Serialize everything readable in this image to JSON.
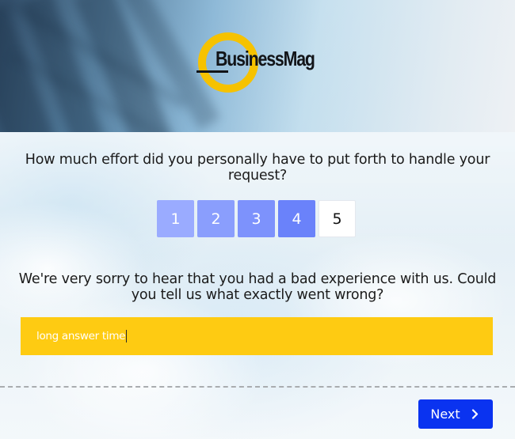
{
  "brand": {
    "name": "BusinessMag",
    "ring_color": "#f6c200"
  },
  "survey": {
    "question_1": "How much effort did you personally have to put forth to handle your request?",
    "rating": {
      "options": [
        {
          "label": "1",
          "color": "#9aabff"
        },
        {
          "label": "2",
          "color": "#8a9efd"
        },
        {
          "label": "3",
          "color": "#7d92fc"
        },
        {
          "label": "4",
          "color": "#6a82fa"
        },
        {
          "label": "5",
          "color": "#ffffff"
        }
      ]
    },
    "question_2": "We're very sorry to hear that you had a bad experience with us. Could you tell us what exactly went wrong?",
    "answer": {
      "value": "long answer time",
      "color": "#fecb12"
    }
  },
  "footer": {
    "next_label": "Next",
    "next_color": "#0a33f0"
  }
}
